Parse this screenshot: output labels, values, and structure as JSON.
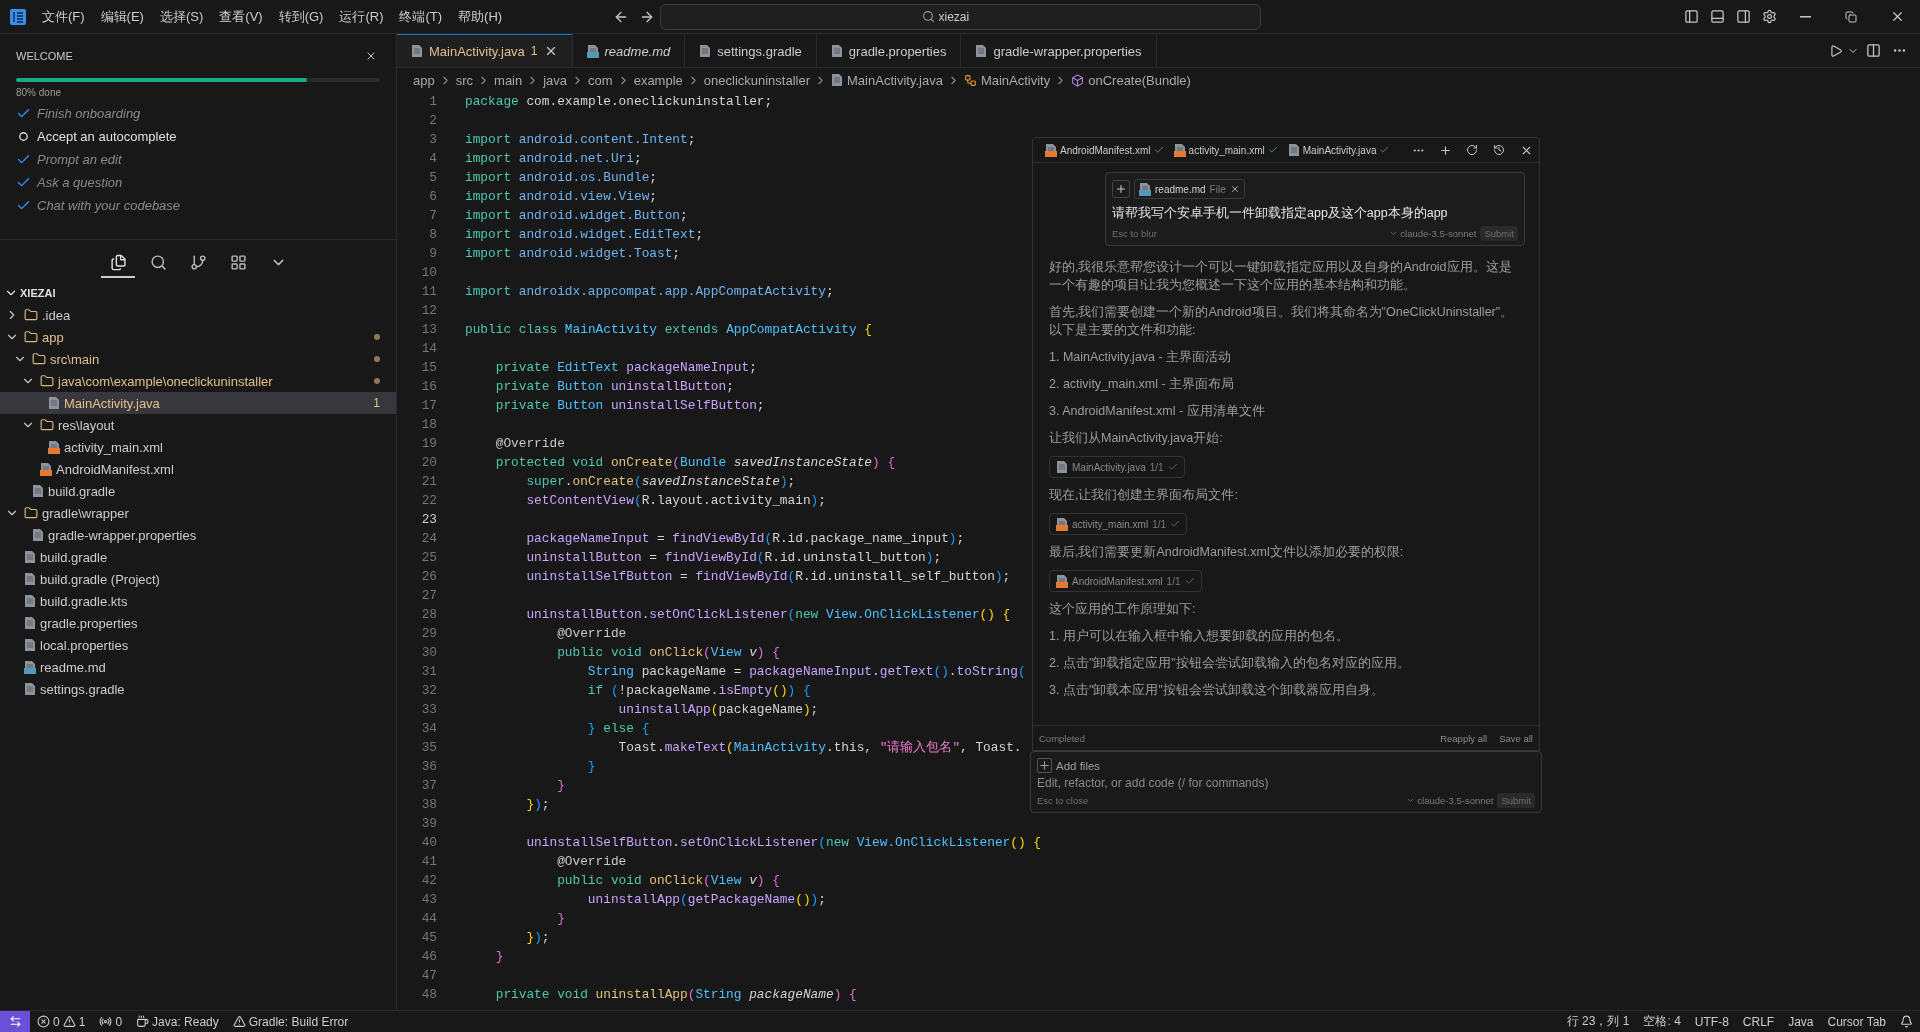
{
  "menu": [
    "文件(F)",
    "编辑(E)",
    "选择(S)",
    "查看(V)",
    "转到(G)",
    "运行(R)",
    "终端(T)",
    "帮助(H)"
  ],
  "search": {
    "value": "xiezai"
  },
  "welcome": {
    "title": "WELCOME",
    "progress": {
      "level": 0.8,
      "label": "80% done"
    },
    "steps": [
      {
        "label": "Finish onboarding",
        "done": true
      },
      {
        "label": "Accept an autocomplete",
        "done": false
      },
      {
        "label": "Prompt an edit",
        "done": true
      },
      {
        "label": "Ask a question",
        "done": true
      },
      {
        "label": "Chat with your codebase",
        "done": true
      }
    ]
  },
  "activity_bar": [
    {
      "kind": "files",
      "selected": true
    },
    {
      "kind": "search",
      "selected": false
    },
    {
      "kind": "git",
      "selected": false
    },
    {
      "kind": "extensions",
      "selected": false
    },
    {
      "kind": "more",
      "selected": false
    }
  ],
  "explorer": {
    "title": "XIEZAI",
    "expanded": true,
    "tree": [
      {
        "label": ".idea",
        "kind": "folder",
        "expanded": false,
        "selected": false,
        "modified": false
      },
      {
        "label": "app",
        "kind": "folder",
        "expanded": true,
        "selected": false,
        "modified": true,
        "children": [
          {
            "label": "src\\main",
            "kind": "folder",
            "expanded": true,
            "selected": false,
            "modified": true,
            "children": [
              {
                "label": "java\\com\\example\\oneclickuninstaller",
                "kind": "folder",
                "expanded": true,
                "selected": false,
                "modified": true,
                "children": [
                  {
                    "label": "MainActivity.java",
                    "kind": "java",
                    "selected": true,
                    "modified": true,
                    "badge": "1"
                  }
                ]
              },
              {
                "label": "res\\layout",
                "kind": "folder",
                "expanded": true,
                "selected": false,
                "modified": false,
                "children": [
                  {
                    "label": "activity_main.xml",
                    "kind": "xml",
                    "selected": false,
                    "modified": false
                  }
                ]
              },
              {
                "label": "AndroidManifest.xml",
                "kind": "xml",
                "selected": false,
                "modified": false
              }
            ]
          },
          {
            "label": "build.gradle",
            "kind": "gradle",
            "selected": false,
            "modified": false
          }
        ]
      },
      {
        "label": "gradle\\wrapper",
        "kind": "folder",
        "expanded": true,
        "selected": false,
        "modified": false,
        "children": [
          {
            "label": "gradle-wrapper.properties",
            "kind": "props",
            "selected": false,
            "modified": false
          }
        ]
      },
      {
        "label": "build.gradle",
        "kind": "gradle",
        "selected": false,
        "modified": false
      },
      {
        "label": "build.gradle (Project)",
        "kind": "gradle",
        "selected": false,
        "modified": false
      },
      {
        "label": "build.gradle.kts",
        "kind": "gradle",
        "selected": false,
        "modified": false
      },
      {
        "label": "gradle.properties",
        "kind": "props",
        "selected": false,
        "modified": false
      },
      {
        "label": "local.properties",
        "kind": "props",
        "selected": false,
        "modified": false
      },
      {
        "label": "readme.md",
        "kind": "md",
        "selected": false,
        "modified": false
      },
      {
        "label": "settings.gradle",
        "kind": "gradle",
        "selected": false,
        "modified": false
      }
    ]
  },
  "tabs": [
    {
      "label": "MainActivity.java",
      "kind": "java",
      "selected": true,
      "preview": false,
      "modified": true,
      "badge": "1"
    },
    {
      "label": "readme.md",
      "kind": "md",
      "selected": false,
      "preview": true,
      "modified": false
    },
    {
      "label": "settings.gradle",
      "kind": "gradle",
      "selected": false,
      "preview": false,
      "modified": false
    },
    {
      "label": "gradle.properties",
      "kind": "props",
      "selected": false,
      "preview": false,
      "modified": false
    },
    {
      "label": "gradle-wrapper.properties",
      "kind": "props",
      "selected": false,
      "preview": false,
      "modified": false
    }
  ],
  "breadcrumb": [
    {
      "label": "app",
      "kind": "folder"
    },
    {
      "label": "src",
      "kind": "folder"
    },
    {
      "label": "main",
      "kind": "folder"
    },
    {
      "label": "java",
      "kind": "folder"
    },
    {
      "label": "com",
      "kind": "folder"
    },
    {
      "label": "example",
      "kind": "folder"
    },
    {
      "label": "oneclickuninstaller",
      "kind": "folder"
    },
    {
      "label": "MainActivity.java",
      "kind": "java"
    },
    {
      "label": "MainActivity",
      "kind": "class"
    },
    {
      "label": "onCreate(Bundle)",
      "kind": "method"
    }
  ],
  "code": {
    "lines": [
      {
        "n": "1",
        "current": false,
        "tokens": [
          {
            "kind": "kw",
            "text": "package"
          },
          {
            "kind": "pl",
            "text": " com.example.oneclickuninstaller;"
          }
        ]
      },
      {
        "n": "2",
        "current": false
      },
      {
        "n": "3",
        "current": false,
        "tokens": [
          {
            "kind": "kw",
            "text": "import"
          },
          {
            "kind": "pk",
            "text": " android.content.Intent"
          },
          {
            "kind": "pl",
            "text": ";"
          }
        ]
      },
      {
        "n": "4",
        "current": false,
        "tokens": [
          {
            "kind": "kw",
            "text": "import"
          },
          {
            "kind": "pk",
            "text": " android.net.Uri"
          },
          {
            "kind": "pl",
            "text": ";"
          }
        ]
      },
      {
        "n": "5",
        "current": false,
        "tokens": [
          {
            "kind": "kw",
            "text": "import"
          },
          {
            "kind": "pk",
            "text": " android.os.Bundle"
          },
          {
            "kind": "pl",
            "text": ";"
          }
        ]
      },
      {
        "n": "6",
        "current": false,
        "tokens": [
          {
            "kind": "kw",
            "text": "import"
          },
          {
            "kind": "pk",
            "text": " android.view.View"
          },
          {
            "kind": "pl",
            "text": ";"
          }
        ]
      },
      {
        "n": "7",
        "current": false,
        "tokens": [
          {
            "kind": "kw",
            "text": "import"
          },
          {
            "kind": "pk",
            "text": " android.widget.Button"
          },
          {
            "kind": "pl",
            "text": ";"
          }
        ]
      },
      {
        "n": "8",
        "current": false,
        "tokens": [
          {
            "kind": "kw",
            "text": "import"
          },
          {
            "kind": "pk",
            "text": " android.widget.EditText"
          },
          {
            "kind": "pl",
            "text": ";"
          }
        ]
      },
      {
        "n": "9",
        "current": false,
        "tokens": [
          {
            "kind": "kw",
            "text": "import"
          },
          {
            "kind": "pk",
            "text": " android.widget.Toast"
          },
          {
            "kind": "pl",
            "text": ";"
          }
        ]
      },
      {
        "n": "10",
        "current": false
      },
      {
        "n": "11",
        "current": false,
        "tokens": [
          {
            "kind": "kw",
            "text": "import"
          },
          {
            "kind": "pk",
            "text": " androidx.appcompat.app.AppCompatActivity"
          },
          {
            "kind": "pl",
            "text": ";"
          }
        ]
      },
      {
        "n": "12",
        "current": false
      },
      {
        "n": "13",
        "current": false,
        "tokens": [
          {
            "kind": "kw",
            "text": "public class "
          },
          {
            "kind": "ty",
            "text": "MainActivity"
          },
          {
            "kind": "kw",
            "text": " extends "
          },
          {
            "kind": "ty",
            "text": "AppCompatActivity"
          },
          {
            "kind": "b1",
            "text": " {"
          }
        ]
      },
      {
        "n": "14",
        "current": false
      },
      {
        "n": "15",
        "current": false,
        "tokens": [
          {
            "kind": "kw",
            "text": "    private "
          },
          {
            "kind": "ty",
            "text": "EditText "
          },
          {
            "kind": "va",
            "text": "packageNameInput"
          },
          {
            "kind": "pl",
            "text": ";"
          }
        ]
      },
      {
        "n": "16",
        "current": false,
        "tokens": [
          {
            "kind": "kw",
            "text": "    private "
          },
          {
            "kind": "ty",
            "text": "Button "
          },
          {
            "kind": "va",
            "text": "uninstallButton"
          },
          {
            "kind": "pl",
            "text": ";"
          }
        ]
      },
      {
        "n": "17",
        "current": false,
        "tokens": [
          {
            "kind": "kw",
            "text": "    private "
          },
          {
            "kind": "ty",
            "text": "Button "
          },
          {
            "kind": "va",
            "text": "uninstallSelfButton"
          },
          {
            "kind": "pl",
            "text": ";"
          }
        ]
      },
      {
        "n": "18",
        "current": false
      },
      {
        "n": "19",
        "current": false,
        "tokens": [
          {
            "kind": "an",
            "text": "    @Override"
          }
        ]
      },
      {
        "n": "20",
        "current": false,
        "tokens": [
          {
            "kind": "kw",
            "text": "    protected void "
          },
          {
            "kind": "fn",
            "text": "onCreate"
          },
          {
            "kind": "b2",
            "text": "("
          },
          {
            "kind": "ty",
            "text": "Bundle "
          },
          {
            "kind": "pa",
            "text": "savedInstanceState"
          },
          {
            "kind": "b2",
            "text": ")"
          },
          {
            "kind": "b2",
            "text": " {"
          }
        ]
      },
      {
        "n": "21",
        "current": false,
        "tokens": [
          {
            "kind": "kw",
            "text": "        super"
          },
          {
            "kind": "pl",
            "text": "."
          },
          {
            "kind": "fn",
            "text": "onCreate"
          },
          {
            "kind": "b3",
            "text": "("
          },
          {
            "kind": "pa",
            "text": "savedInstanceState"
          },
          {
            "kind": "b3",
            "text": ")"
          },
          {
            "kind": "pl",
            "text": ";"
          }
        ]
      },
      {
        "n": "22",
        "current": false,
        "tokens": [
          {
            "kind": "fc",
            "text": "        setContentView"
          },
          {
            "kind": "b3",
            "text": "("
          },
          {
            "kind": "pl",
            "text": "R.layout.activity_main"
          },
          {
            "kind": "b3",
            "text": ")"
          },
          {
            "kind": "pl",
            "text": ";"
          }
        ]
      },
      {
        "n": "23",
        "current": true
      },
      {
        "n": "24",
        "current": false,
        "tokens": [
          {
            "kind": "va",
            "text": "        packageNameInput"
          },
          {
            "kind": "pl",
            "text": " = "
          },
          {
            "kind": "fc",
            "text": "findViewById"
          },
          {
            "kind": "b3",
            "text": "("
          },
          {
            "kind": "pl",
            "text": "R.id.package_name_input"
          },
          {
            "kind": "b3",
            "text": ")"
          },
          {
            "kind": "pl",
            "text": ";"
          }
        ]
      },
      {
        "n": "25",
        "current": false,
        "tokens": [
          {
            "kind": "va",
            "text": "        uninstallButton"
          },
          {
            "kind": "pl",
            "text": " = "
          },
          {
            "kind": "fc",
            "text": "findViewById"
          },
          {
            "kind": "b3",
            "text": "("
          },
          {
            "kind": "pl",
            "text": "R.id.uninstall_button"
          },
          {
            "kind": "b3",
            "text": ")"
          },
          {
            "kind": "pl",
            "text": ";"
          }
        ]
      },
      {
        "n": "26",
        "current": false,
        "tokens": [
          {
            "kind": "va",
            "text": "        uninstallSelfButton"
          },
          {
            "kind": "pl",
            "text": " = "
          },
          {
            "kind": "fc",
            "text": "findViewById"
          },
          {
            "kind": "b3",
            "text": "("
          },
          {
            "kind": "pl",
            "text": "R.id.uninstall_self_button"
          },
          {
            "kind": "b3",
            "text": ")"
          },
          {
            "kind": "pl",
            "text": ";"
          }
        ]
      },
      {
        "n": "27",
        "current": false
      },
      {
        "n": "28",
        "current": false,
        "tokens": [
          {
            "kind": "va",
            "text": "        uninstallButton"
          },
          {
            "kind": "pl",
            "text": "."
          },
          {
            "kind": "fc",
            "text": "setOnClickListener"
          },
          {
            "kind": "b3",
            "text": "("
          },
          {
            "kind": "kw",
            "text": "new "
          },
          {
            "kind": "ty",
            "text": "View.OnClickListener"
          },
          {
            "kind": "b1",
            "text": "() {"
          }
        ]
      },
      {
        "n": "29",
        "current": false,
        "tokens": [
          {
            "kind": "an",
            "text": "            @Override"
          }
        ]
      },
      {
        "n": "30",
        "current": false,
        "tokens": [
          {
            "kind": "kw",
            "text": "            public void "
          },
          {
            "kind": "fn",
            "text": "onClick"
          },
          {
            "kind": "b2",
            "text": "("
          },
          {
            "kind": "ty",
            "text": "View "
          },
          {
            "kind": "pa",
            "text": "v"
          },
          {
            "kind": "b2",
            "text": ")"
          },
          {
            "kind": "b2",
            "text": " {"
          }
        ]
      },
      {
        "n": "31",
        "current": false,
        "tokens": [
          {
            "kind": "ty",
            "text": "                String "
          },
          {
            "kind": "pl",
            "text": "packageName = "
          },
          {
            "kind": "va",
            "text": "packageNameInput"
          },
          {
            "kind": "pl",
            "text": "."
          },
          {
            "kind": "fc",
            "text": "getText"
          },
          {
            "kind": "b3",
            "text": "()"
          },
          {
            "kind": "pl",
            "text": "."
          },
          {
            "kind": "fc",
            "text": "toString"
          },
          {
            "kind": "b3",
            "text": "("
          }
        ]
      },
      {
        "n": "32",
        "current": false,
        "tokens": [
          {
            "kind": "kw",
            "text": "                if "
          },
          {
            "kind": "b3",
            "text": "("
          },
          {
            "kind": "pl",
            "text": "!packageName."
          },
          {
            "kind": "fc",
            "text": "isEmpty"
          },
          {
            "kind": "b1",
            "text": "()"
          },
          {
            "kind": "b3",
            "text": ")"
          },
          {
            "kind": "b3",
            "text": " {"
          }
        ]
      },
      {
        "n": "33",
        "current": false,
        "tokens": [
          {
            "kind": "fc",
            "text": "                    uninstallApp"
          },
          {
            "kind": "b1",
            "text": "("
          },
          {
            "kind": "pl",
            "text": "packageName"
          },
          {
            "kind": "b1",
            "text": ")"
          },
          {
            "kind": "pl",
            "text": ";"
          }
        ]
      },
      {
        "n": "34",
        "current": false,
        "tokens": [
          {
            "kind": "b3",
            "text": "                }"
          },
          {
            "kind": "kw",
            "text": " else "
          },
          {
            "kind": "b3",
            "text": "{"
          }
        ]
      },
      {
        "n": "35",
        "current": false,
        "tokens": [
          {
            "kind": "pl",
            "text": "                    Toast."
          },
          {
            "kind": "fc",
            "text": "makeText"
          },
          {
            "kind": "b1",
            "text": "("
          },
          {
            "kind": "ty",
            "text": "MainActivity"
          },
          {
            "kind": "pl",
            "text": ".this, "
          },
          {
            "kind": "st",
            "text": "\"请输入包名\""
          },
          {
            "kind": "pl",
            "text": ", Toast."
          }
        ]
      },
      {
        "n": "36",
        "current": false,
        "tokens": [
          {
            "kind": "b3",
            "text": "                }"
          }
        ]
      },
      {
        "n": "37",
        "current": false,
        "tokens": [
          {
            "kind": "b2",
            "text": "            }"
          }
        ]
      },
      {
        "n": "38",
        "current": false,
        "tokens": [
          {
            "kind": "b1",
            "text": "        }"
          },
          {
            "kind": "b3",
            "text": ")"
          },
          {
            "kind": "pl",
            "text": ";"
          }
        ]
      },
      {
        "n": "39",
        "current": false
      },
      {
        "n": "40",
        "current": false,
        "tokens": [
          {
            "kind": "va",
            "text": "        uninstallSelfButton"
          },
          {
            "kind": "pl",
            "text": "."
          },
          {
            "kind": "fc",
            "text": "setOnClickListener"
          },
          {
            "kind": "b3",
            "text": "("
          },
          {
            "kind": "kw",
            "text": "new "
          },
          {
            "kind": "ty",
            "text": "View.OnClickListener"
          },
          {
            "kind": "b1",
            "text": "() {"
          }
        ]
      },
      {
        "n": "41",
        "current": false,
        "tokens": [
          {
            "kind": "an",
            "text": "            @Override"
          }
        ]
      },
      {
        "n": "42",
        "current": false,
        "tokens": [
          {
            "kind": "kw",
            "text": "            public void "
          },
          {
            "kind": "fn",
            "text": "onClick"
          },
          {
            "kind": "b2",
            "text": "("
          },
          {
            "kind": "ty",
            "text": "View "
          },
          {
            "kind": "pa",
            "text": "v"
          },
          {
            "kind": "b2",
            "text": ")"
          },
          {
            "kind": "b2",
            "text": " {"
          }
        ]
      },
      {
        "n": "43",
        "current": false,
        "tokens": [
          {
            "kind": "fc",
            "text": "                uninstallApp"
          },
          {
            "kind": "b3",
            "text": "("
          },
          {
            "kind": "fc",
            "text": "getPackageName"
          },
          {
            "kind": "b1",
            "text": "()"
          },
          {
            "kind": "b3",
            "text": ")"
          },
          {
            "kind": "pl",
            "text": ";"
          }
        ]
      },
      {
        "n": "44",
        "current": false,
        "tokens": [
          {
            "kind": "b2",
            "text": "            }"
          }
        ]
      },
      {
        "n": "45",
        "current": false,
        "tokens": [
          {
            "kind": "b1",
            "text": "        }"
          },
          {
            "kind": "b3",
            "text": ")"
          },
          {
            "kind": "pl",
            "text": ";"
          }
        ]
      },
      {
        "n": "46",
        "current": false,
        "tokens": [
          {
            "kind": "b2",
            "text": "    }"
          }
        ]
      },
      {
        "n": "47",
        "current": false
      },
      {
        "n": "48",
        "current": false,
        "tokens": [
          {
            "kind": "kw",
            "text": "    private void "
          },
          {
            "kind": "fn",
            "text": "uninstallApp"
          },
          {
            "kind": "b2",
            "text": "("
          },
          {
            "kind": "ty",
            "text": "String "
          },
          {
            "kind": "pa",
            "text": "packageName"
          },
          {
            "kind": "b2",
            "text": ")"
          },
          {
            "kind": "b2",
            "text": " {"
          }
        ]
      }
    ]
  },
  "composer": {
    "files": [
      {
        "label": "AndroidManifest.xml",
        "kind": "xml",
        "accepted": true
      },
      {
        "label": "activity_main.xml",
        "kind": "xml",
        "accepted": true
      },
      {
        "label": "MainActivity.java",
        "kind": "java",
        "accepted": true
      }
    ],
    "prompt": {
      "attachment": {
        "label": "readme.md",
        "kind": "md",
        "type": "File"
      },
      "text": "请帮我写个安卓手机一件卸载指定app及这个app本身的app",
      "hint": "Esc to blur",
      "model": "claude-3.5-sonnet",
      "submit": "Submit"
    },
    "messages": [
      {
        "kind": "text",
        "text": "好的,我很乐意帮您设计一个可以一键卸载指定应用以及自身的Android应用。这是一个有趣的项目!让我为您概述一下这个应用的基本结构和功能。"
      },
      {
        "kind": "text",
        "text": "首先,我们需要创建一个新的Android项目。我们将其命名为\"OneClickUninstaller\"。以下是主要的文件和功能:"
      },
      {
        "kind": "text",
        "text": "1. MainActivity.java - 主界面活动"
      },
      {
        "kind": "text",
        "text": "2. activity_main.xml - 主界面布局"
      },
      {
        "kind": "text",
        "text": "3. AndroidManifest.xml - 应用清单文件"
      },
      {
        "kind": "text",
        "text": "让我们从MainActivity.java开始:"
      },
      {
        "kind": "file",
        "file": {
          "label": "MainActivity.java",
          "kind": "java"
        },
        "count": "1/1",
        "accepted": true
      },
      {
        "kind": "text",
        "text": "现在,让我们创建主界面布局文件:"
      },
      {
        "kind": "file",
        "file": {
          "label": "activity_main.xml",
          "kind": "xml"
        },
        "count": "1/1",
        "accepted": true
      },
      {
        "kind": "text",
        "text": "最后,我们需要更新AndroidManifest.xml文件以添加必要的权限:"
      },
      {
        "kind": "file",
        "file": {
          "label": "AndroidManifest.xml",
          "kind": "xml"
        },
        "count": "1/1",
        "accepted": true
      },
      {
        "kind": "text",
        "text": "这个应用的工作原理如下:"
      },
      {
        "kind": "text",
        "text": "1. 用户可以在输入框中输入想要卸载的应用的包名。"
      },
      {
        "kind": "text",
        "text": "2. 点击\"卸载指定应用\"按钮会尝试卸载输入的包名对应的应用。"
      },
      {
        "kind": "text",
        "text": "3. 点击\"卸载本应用\"按钮会尝试卸载这个卸载器应用自身。"
      }
    ],
    "footer": {
      "status": "Completed",
      "actions": [
        "Reapply all",
        "Save all"
      ]
    },
    "input": {
      "add_files": "Add files",
      "placeholder": "Edit, refactor, or add code (/ for commands)",
      "hint": "Esc to close",
      "model": "claude-3.5-sonnet",
      "submit": "Submit"
    }
  },
  "status_bar": {
    "errors": "0",
    "warnings": "1",
    "ports": "0",
    "left": [
      {
        "kind": "java",
        "label": "Java: Ready"
      },
      {
        "kind": "gradle",
        "label": "Gradle: Build Error"
      }
    ],
    "right": [
      "行 23，列 1",
      "空格: 4",
      "UTF-8",
      "CRLF",
      "Java",
      "Cursor Tab"
    ]
  }
}
